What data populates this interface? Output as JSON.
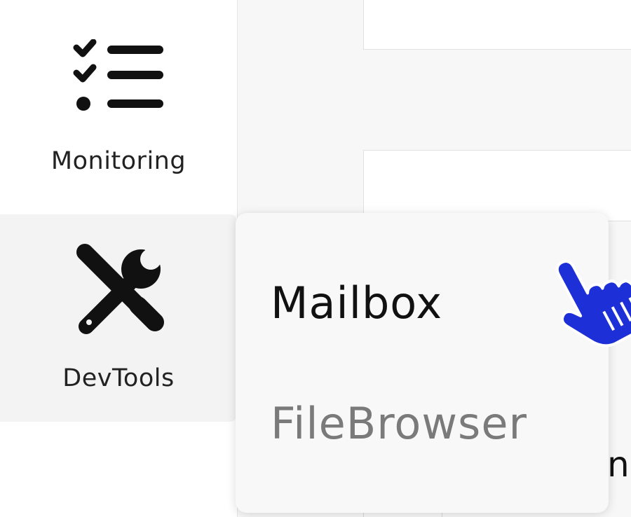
{
  "sidebar": {
    "items": [
      {
        "label": "Monitoring",
        "icon": "checklist-icon"
      },
      {
        "label": "DevTools",
        "icon": "tools-icon",
        "active": true
      }
    ]
  },
  "submenu": {
    "items": [
      {
        "label": "Mailbox",
        "hovered": true
      },
      {
        "label": "FileBrowser"
      }
    ]
  },
  "background_text": "n",
  "colors": {
    "cursor": "#1d2fd6",
    "active_nav_background": "#f3f3f3",
    "muted_text": "#7a7a7a"
  }
}
